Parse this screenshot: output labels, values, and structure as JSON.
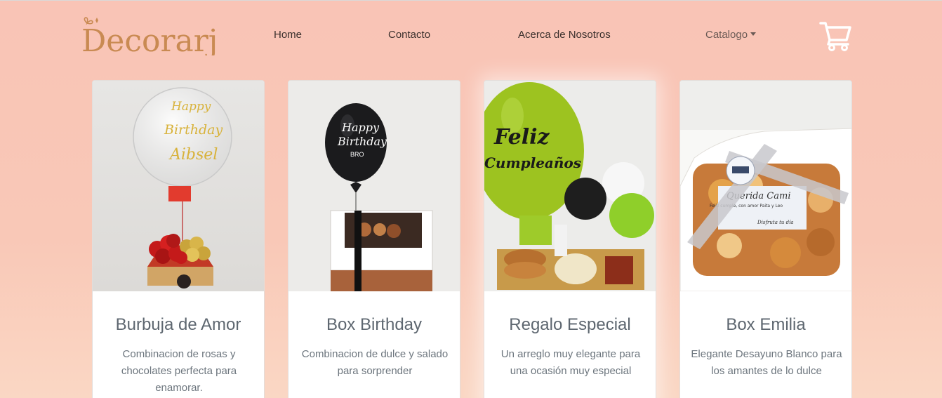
{
  "brand": {
    "name": "Decorarj",
    "color": "#c98a52"
  },
  "nav": {
    "home": "Home",
    "contacto": "Contacto",
    "acerca": "Acerca de Nosotros",
    "catalogo": "Catalogo"
  },
  "cart": {
    "icon": "shopping-cart-icon"
  },
  "products": [
    {
      "title": "Burbuja de Amor",
      "description": "Combinacion de rosas y chocolates perfecta para enamorar.",
      "balloon_text": [
        "Happy",
        "Birthday",
        "Aibsel"
      ]
    },
    {
      "title": "Box Birthday",
      "description": "Combinacion de dulce y salado para sorprender",
      "balloon_text": [
        "Happy",
        "Birthday",
        "BRO"
      ]
    },
    {
      "title": "Regalo Especial",
      "description": "Un arreglo muy elegante para una ocasión muy especial",
      "balloon_text": [
        "Feliz",
        "Cumpleaños"
      ]
    },
    {
      "title": "Box Emilia",
      "description": "Elegante Desayuno Blanco para los amantes de lo dulce",
      "balloon_text": [
        "Querida Cami",
        "Feliz cumple, con amor Paita y Leo",
        "Disfruta tu día"
      ]
    }
  ]
}
